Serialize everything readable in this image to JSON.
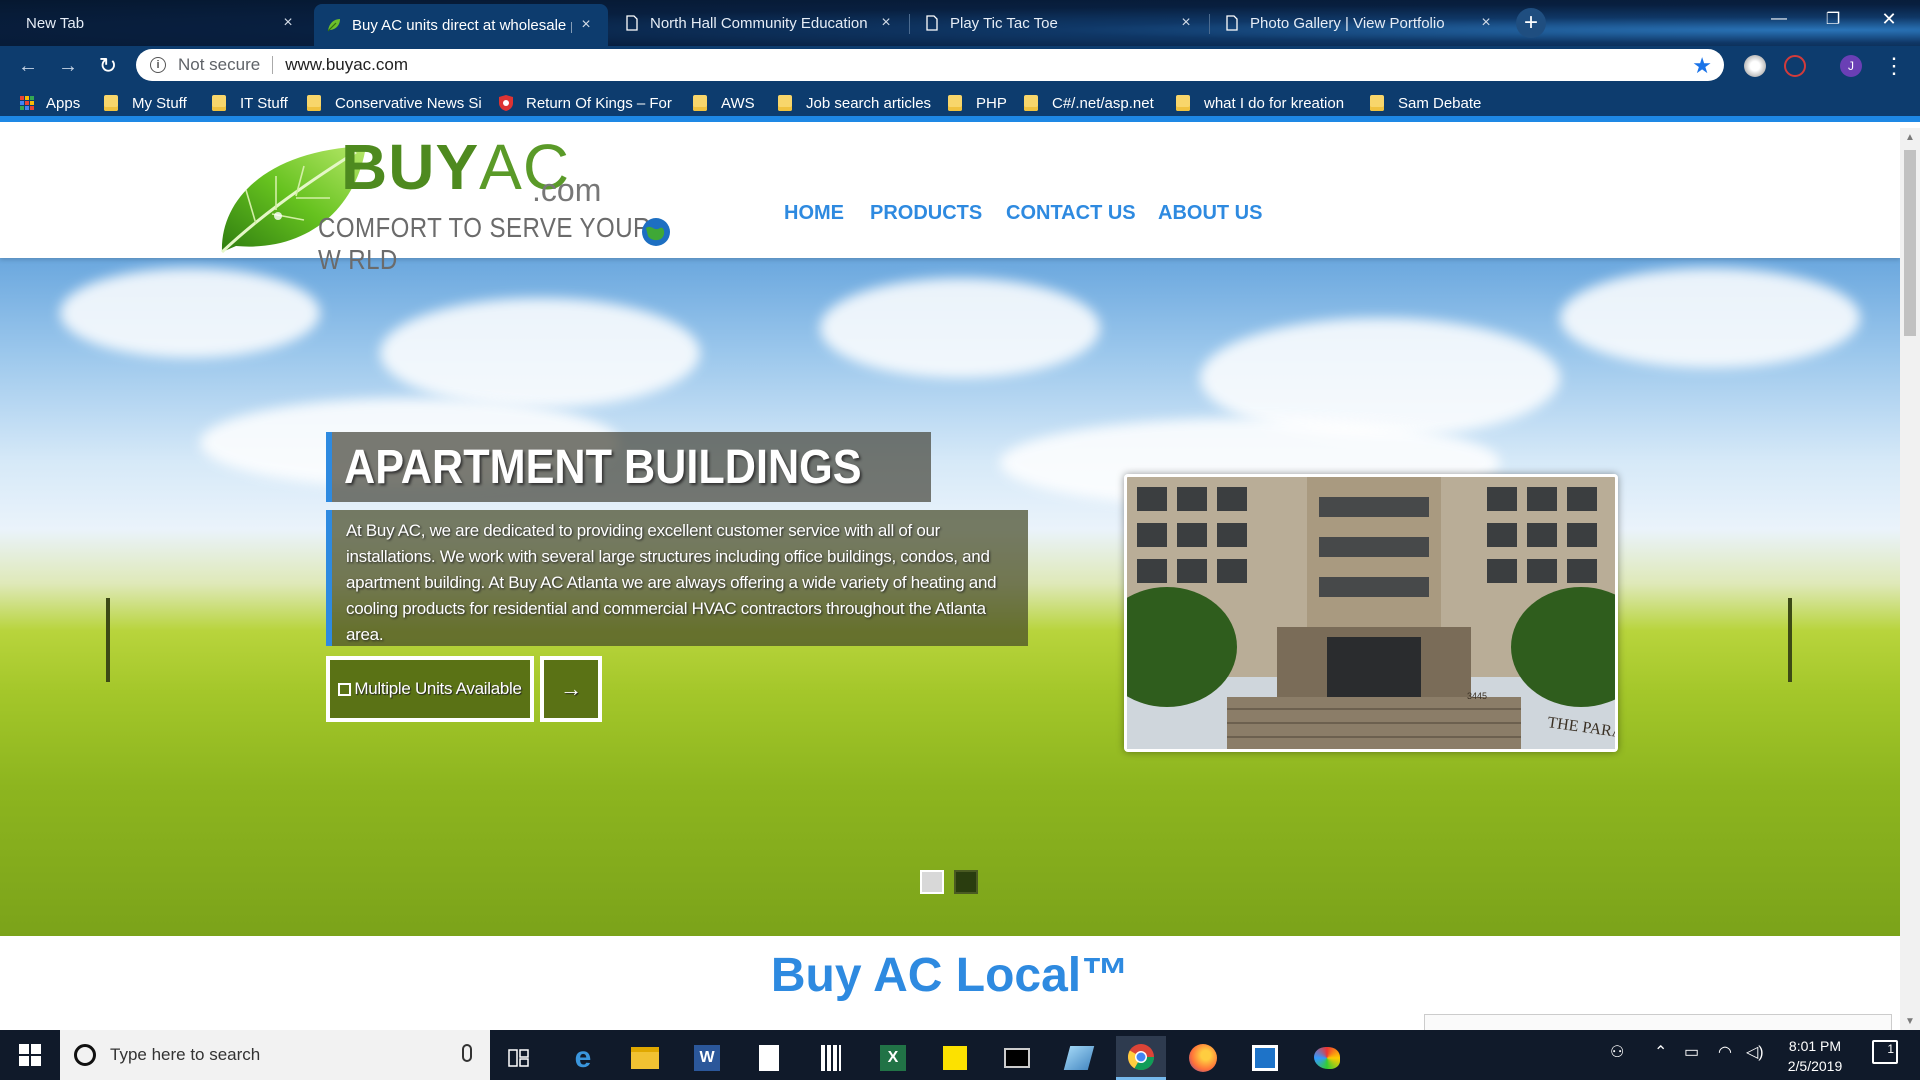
{
  "browser": {
    "tabs": [
      {
        "label": "New Tab",
        "close": "×"
      },
      {
        "label": "Buy AC units direct at wholesale p",
        "close": "×"
      },
      {
        "label": "North Hall Community Education",
        "close": "×"
      },
      {
        "label": "Play Tic Tac Toe",
        "close": "×"
      },
      {
        "label": "Photo Gallery | View Portfolio",
        "close": "×"
      }
    ],
    "new_tab": "+",
    "window_controls": {
      "minimize": "—",
      "restore": "❐",
      "close": "✕"
    },
    "nav": {
      "back": "←",
      "forward": "→",
      "reload": "↻"
    },
    "omnibox": {
      "security": "Not secure",
      "url": "www.buyac.com",
      "info": "i",
      "star": "★"
    },
    "profile_initial": "J",
    "menu": "⋮",
    "bookmarks": [
      {
        "label": "Apps",
        "kind": "apps"
      },
      {
        "label": "My Stuff",
        "kind": "folder"
      },
      {
        "label": "IT Stuff",
        "kind": "folder"
      },
      {
        "label": "Conservative News Si",
        "kind": "folder"
      },
      {
        "label": "Return Of Kings – For",
        "kind": "shield"
      },
      {
        "label": "AWS",
        "kind": "folder"
      },
      {
        "label": "Job search articles",
        "kind": "folder"
      },
      {
        "label": "PHP",
        "kind": "folder"
      },
      {
        "label": "C#/.net/asp.net",
        "kind": "folder"
      },
      {
        "label": "what I do for kreation",
        "kind": "folder"
      },
      {
        "label": "Sam Debate",
        "kind": "folder"
      }
    ]
  },
  "site": {
    "logo": {
      "buy": "BUY",
      "ac": "AC",
      "com": ".com",
      "tagline": "COMFORT TO SERVE YOUR W   RLD"
    },
    "nav": [
      "HOME",
      "PRODUCTS",
      "CONTACT US",
      "ABOUT US"
    ],
    "hero": {
      "title": "APARTMENT BUILDINGS",
      "text": "At Buy AC, we are dedicated to providing excellent customer service with all of our installations. We work with several large structures including office buildings, condos, and apartment building. At Buy AC Atlanta we are always offering a wide variety of heating and cooling products for residential and commercial HVAC contractors throughout the Atlanta area.",
      "button_label": "Multiple Units Available",
      "arrow_label": "→",
      "image_sign": "THE PARAMOUNT",
      "image_number": "3445"
    },
    "section_title": "Buy AC Local™"
  },
  "taskbar": {
    "search_placeholder": "Type here to search",
    "time": "8:01 PM",
    "date": "2/5/2019",
    "notification_count": "1"
  },
  "colors": {
    "accent": "#2e8ae0",
    "brand_green": "#4e8a1f",
    "chrome": "#0d3c6e"
  }
}
